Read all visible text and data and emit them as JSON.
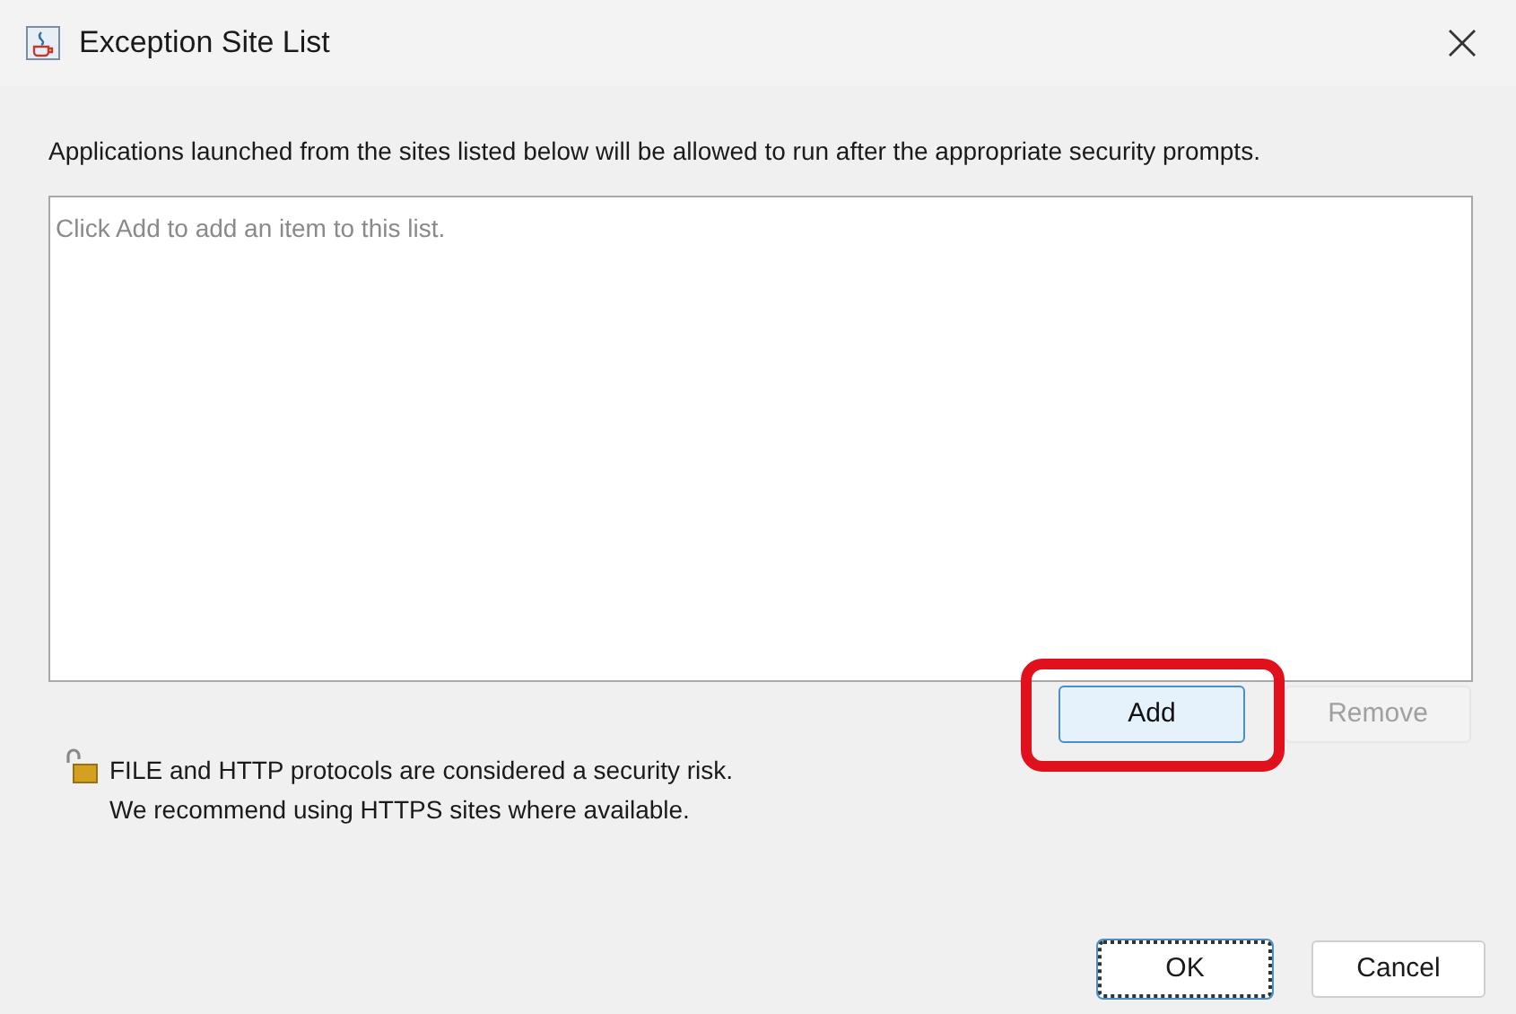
{
  "window": {
    "title": "Exception Site List"
  },
  "description": "Applications launched from the sites listed below will be allowed to run after the appropriate security prompts.",
  "site_list": {
    "placeholder": "Click Add to add an item to this list."
  },
  "list_buttons": [
    {
      "label": "Add",
      "disabled": false,
      "highlighted": true
    },
    {
      "label": "Remove",
      "disabled": true,
      "highlighted": false
    }
  ],
  "warning": {
    "lines": [
      "FILE and HTTP protocols are considered a security risk.",
      "We recommend using HTTPS sites where available."
    ]
  },
  "dialog_buttons": [
    {
      "label": "OK",
      "focused": true
    },
    {
      "label": "Cancel",
      "focused": false
    }
  ]
}
